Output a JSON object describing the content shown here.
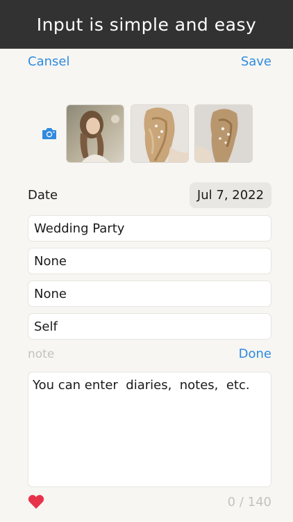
{
  "banner": {
    "text": "Input is simple and easy"
  },
  "nav": {
    "cancel_label": "Cansel",
    "save_label": "Save"
  },
  "photos": {
    "camera_icon": "camera-icon",
    "items": [
      "bride-photo-1",
      "bride-hair-photo-2",
      "bride-hair-photo-3"
    ]
  },
  "date": {
    "label": "Date",
    "value": "Jul 7, 2022"
  },
  "fields": {
    "event": "Wedding Party",
    "field2": "None",
    "field3": "None",
    "field4": "Self"
  },
  "note": {
    "label": "note",
    "done_label": "Done",
    "text": "You can enter  diaries,  notes,  etc.",
    "counter": "0 / 140"
  },
  "colors": {
    "accent": "#2f8ae0",
    "banner": "#323232",
    "heart": "#e8324b",
    "background": "#f7f6f2"
  },
  "icons": {
    "heart": "heart-icon",
    "camera": "camera-icon"
  }
}
